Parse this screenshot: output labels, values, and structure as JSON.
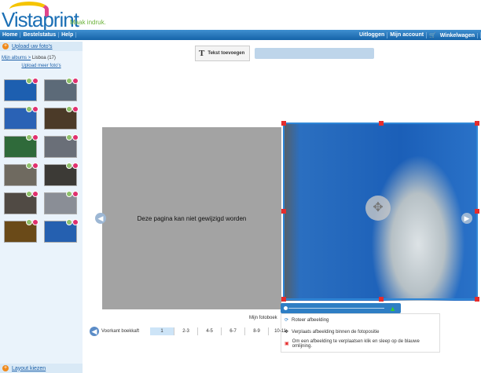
{
  "header": {
    "brand": "Vistaprint",
    "tagline": "Maak indruk."
  },
  "nav": {
    "left": [
      "Home",
      "Bestelstatus",
      "Help"
    ],
    "right": [
      "Uitloggen",
      "Mijn account",
      "Winkelwagen"
    ]
  },
  "sidebar": {
    "upload_new": "Upload uw foto's",
    "breadcrumb": "Mijn albums >",
    "album": "Lisboa (17)",
    "upload_more": "Upload meer foto's",
    "thumb_count": 12,
    "layout": "Layout kiezen"
  },
  "toolbar": {
    "add_text": "Tekst toevoegen"
  },
  "book": {
    "left_notice": "Deze pagina kan niet gewijzigd worden",
    "title": "Mijn fotoboek"
  },
  "popup": {
    "items": [
      "Roteer afbeelding",
      "Verplaats afbeelding binnen de fotopositie",
      "Om een afbeelding te verplaatsen klik en sleep op de blauwe omlijning."
    ]
  },
  "pagination": {
    "cover": "Voorkant boekkaft",
    "pages": [
      "1",
      "2-3",
      "4-5",
      "6-7",
      "8-9",
      "10-11"
    ],
    "current": "1"
  }
}
